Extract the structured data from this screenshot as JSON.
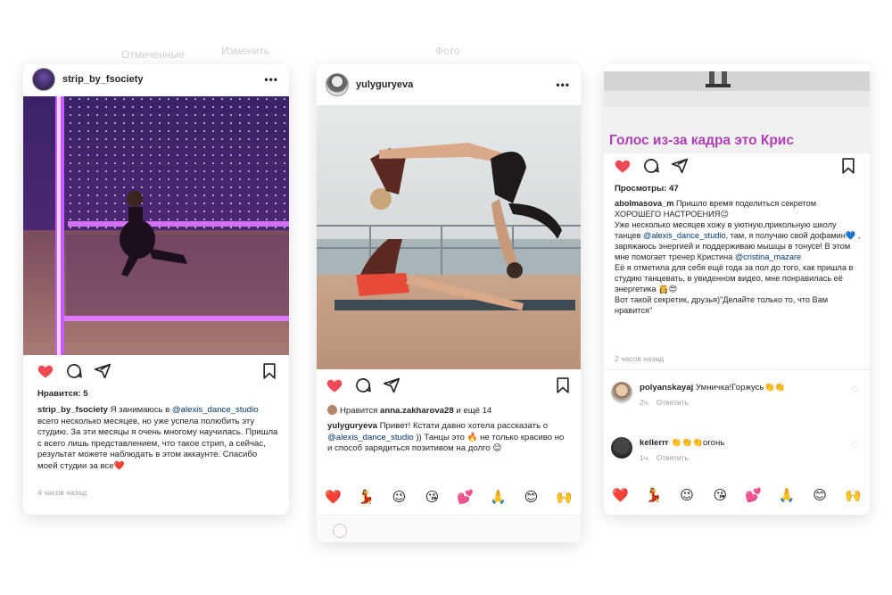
{
  "left_card": {
    "ghost_title": "Отмеченные",
    "ghost_action": "Изменить",
    "username": "strip_by_fsociety",
    "more": "•••",
    "likes": "Нравится: 5",
    "caption_user": "strip_by_fsociety",
    "caption_pre": " Я занимаюсь в ",
    "caption_mention": "@alexis_dance_studio",
    "caption_post": " всего несколько месяцев, но уже успела полюбить эту студию. За эти месяцы я очень многому научилась. Пришла с всего лишь представлением, что такое стрип, а сейчас, результат можете наблюдать в этом аккаунте. Спасибо моей студии за все❤️",
    "time": "4 часов назад"
  },
  "middle_card": {
    "ghost_title": "Фото",
    "username": "yulyguryeva",
    "more": "•••",
    "liked_pre": "Нравится ",
    "liked_user": "anna.zakharova28",
    "liked_post": " и ещё 14",
    "caption_user": "yulyguryeva",
    "caption_pre": " Привет! Кстати давно хотела рассказать о ",
    "caption_mention": "@alexis_dance_studio",
    "caption_post": " )) Танцы это 🔥 не только красиво но и способ зарядиться позитивом на долго 😉",
    "emojis": [
      "❤️",
      "💃",
      "😉",
      "😘",
      "💕",
      "🙏",
      "😊",
      "🙌"
    ]
  },
  "right_card": {
    "overlay_text": "Голос из-за кадра это Крис",
    "views": "Просмотры: 47",
    "caption_user": "abolmasova_m",
    "caption_1": " Пришло время поделиться секретом ХОРОШЕГО НАСТРОЕНИЯ😉",
    "caption_2": "Уже несколько месяцев хожу в уютную,прикольную школу танцев ",
    "caption_mention": "@alexis_dance_studio",
    "caption_3": ", там, я получаю свой дофамин💙 , заряжаюсь энергией и поддерживаю мышцы в тонусе! В этом мне помогает тренер Кристина ",
    "caption_mention2": "@cristina_mazare",
    "caption_4": "Её я отметила для себя ещё года за пол до того, как пришла в студию танцевать, в увиденном видео, мне понравилась её энергетика 👸😍",
    "caption_5": "Вот такой секретик, друзья)\"Делайте только то, что Вам нравится\"",
    "time": "2 часов назад",
    "comments": [
      {
        "user": "polyanskayaj",
        "text": " Умничка!Горжусь👏👏",
        "age": "2ч.",
        "reply": "Ответить"
      },
      {
        "user": "kellerrr",
        "text": " 👏👏👏огонь",
        "age": "1ч.",
        "reply": "Ответить"
      }
    ],
    "emojis": [
      "❤️",
      "💃",
      "😉",
      "😘",
      "💕",
      "🙏",
      "😊",
      "🙌"
    ]
  },
  "colors": {
    "heart": "#ed4956",
    "link": "#00376b",
    "overlay_text": "#b03fb5",
    "neon": "#c04bff"
  }
}
